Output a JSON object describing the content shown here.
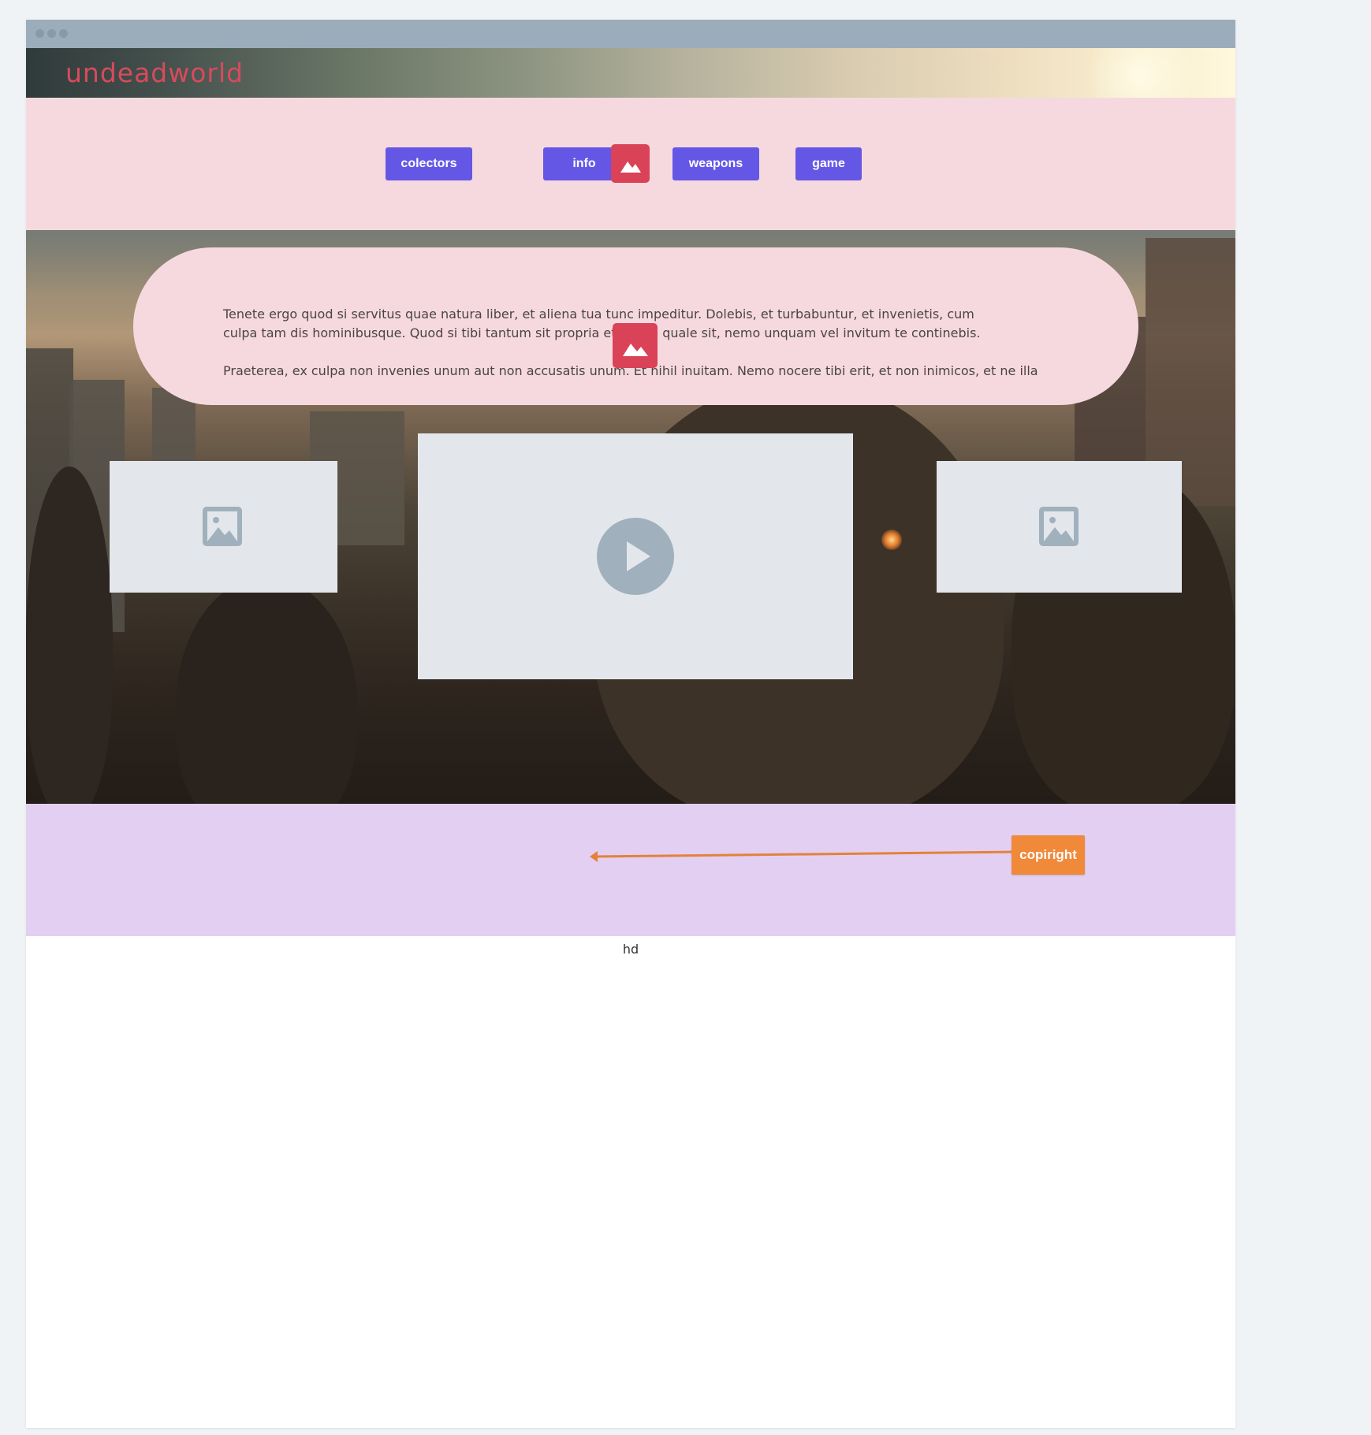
{
  "app": {
    "logo": "undeadworld"
  },
  "nav": {
    "items": [
      {
        "label": "colectors"
      },
      {
        "label": "info"
      },
      {
        "label": "weapons"
      },
      {
        "label": "game"
      }
    ]
  },
  "content": {
    "paragraph_1": "Tenete ergo quod si servitus quae natura liber, et aliena tua tunc impeditur. Dolebis, et turbabuntur, et invenietis, cum culpa tam dis hominibusque. Quod si tibi tantum sit propria et aliena quale sit, nemo unquam vel invitum te continebis.",
    "paragraph_2": "Praeterea, ex culpa non invenies unum aut non accusatis unum. Et nihil inuitam. Nemo nocere tibi erit, et non inimicos, et ne illa"
  },
  "media": {
    "left_icon": "image-placeholder-icon",
    "center_icon": "play-icon",
    "right_icon": "image-placeholder-icon"
  },
  "footer": {
    "copyright_label": "copiright"
  },
  "bottom_text": "hd",
  "colors": {
    "nav_button": "#6457e6",
    "logo": "#d94a5c",
    "nav_band": "#f6d9de",
    "footer_band": "#e3cff2",
    "copyright_button": "#f0893a",
    "image_badge": "#d94257"
  }
}
